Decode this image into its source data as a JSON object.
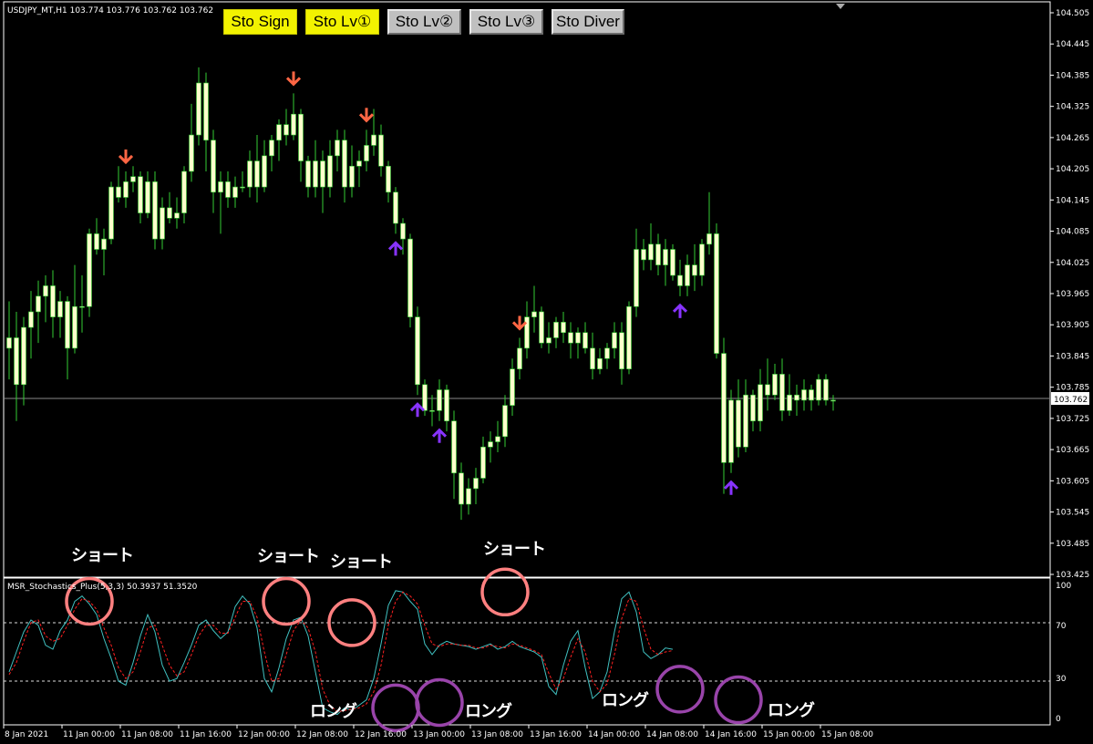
{
  "header": {
    "symbol_info": "USDJPY_MT,H1  103.774 103.776 103.762 103.762",
    "indicator_info": "MSR_Stochastics_Plus(5,3,3) 50.3937 51.3520"
  },
  "buttons": [
    {
      "label": "Sto Sign",
      "active": true
    },
    {
      "label": "Sto Lv①",
      "active": true
    },
    {
      "label": "Sto Lv②",
      "active": false
    },
    {
      "label": "Sto Lv③",
      "active": false
    },
    {
      "label": "Sto Diver",
      "active": false
    }
  ],
  "price_axis": {
    "ticks": [
      "104.505",
      "104.445",
      "104.385",
      "104.325",
      "104.265",
      "104.205",
      "104.145",
      "104.085",
      "104.025",
      "103.965",
      "103.905",
      "103.845",
      "103.785",
      "103.725",
      "103.665",
      "103.605",
      "103.545",
      "103.485",
      "103.425"
    ],
    "current_price": "103.762"
  },
  "osc_axis": {
    "ticks": [
      "100",
      "70",
      "30",
      "0"
    ]
  },
  "time_axis": {
    "labels": [
      "8 Jan 2021",
      "11 Jan 00:00",
      "11 Jan 08:00",
      "11 Jan 16:00",
      "12 Jan 00:00",
      "12 Jan 08:00",
      "12 Jan 16:00",
      "13 Jan 00:00",
      "13 Jan 08:00",
      "13 Jan 16:00",
      "14 Jan 00:00",
      "14 Jan 08:00",
      "14 Jan 16:00",
      "15 Jan 00:00",
      "15 Jan 08:00"
    ]
  },
  "annotations": {
    "short_1": "ショート",
    "short_2": "ショート",
    "short_3": "ショート",
    "short_4": "ショート",
    "long_1": "ロング",
    "long_2": "ロング",
    "long_3": "ロング",
    "long_4": "ロング"
  },
  "colors": {
    "bull_candle": "#ffffcc",
    "bear_candle": "#ffffcc",
    "wick": "#33cc33",
    "sell_arrow": "#ff6644",
    "buy_arrow": "#8833ff",
    "stoch_main": "#40c0c0",
    "stoch_signal": "#ff2020",
    "short_circle": "#ff8080",
    "long_circle": "#9944aa",
    "button_active": "#f2f200",
    "button_inactive": "#c0c0c0"
  },
  "chart_data": [
    {
      "type": "candlestick",
      "title": "USDJPY_MT,H1",
      "ylim": [
        103.425,
        104.52
      ],
      "candles": [
        [
          103.86,
          103.95,
          103.8,
          103.88
        ],
        [
          103.88,
          103.93,
          103.72,
          103.79
        ],
        [
          103.79,
          103.92,
          103.75,
          103.9
        ],
        [
          103.9,
          103.97,
          103.84,
          103.93
        ],
        [
          103.93,
          103.99,
          103.87,
          103.96
        ],
        [
          103.96,
          104.0,
          103.91,
          103.98
        ],
        [
          103.98,
          104.01,
          103.88,
          103.92
        ],
        [
          103.92,
          103.97,
          103.88,
          103.95
        ],
        [
          103.95,
          103.96,
          103.8,
          103.86
        ],
        [
          103.86,
          104.02,
          103.85,
          103.94
        ],
        [
          103.94,
          104.0,
          103.89,
          103.94
        ],
        [
          103.94,
          104.09,
          103.92,
          104.08
        ],
        [
          104.08,
          104.11,
          104.04,
          104.05
        ],
        [
          104.05,
          104.09,
          104.0,
          104.07
        ],
        [
          104.07,
          104.18,
          104.06,
          104.17
        ],
        [
          104.17,
          104.21,
          104.14,
          104.15
        ],
        [
          104.15,
          104.2,
          104.13,
          104.18
        ],
        [
          104.18,
          104.21,
          104.16,
          104.19
        ],
        [
          104.19,
          104.2,
          104.1,
          104.12
        ],
        [
          104.12,
          104.2,
          104.11,
          104.18
        ],
        [
          104.18,
          104.2,
          104.05,
          104.07
        ],
        [
          104.07,
          104.15,
          104.05,
          104.13
        ],
        [
          104.13,
          104.16,
          104.1,
          104.11
        ],
        [
          104.11,
          104.15,
          104.09,
          104.12
        ],
        [
          104.12,
          104.21,
          104.1,
          104.2
        ],
        [
          104.2,
          104.33,
          104.18,
          104.27
        ],
        [
          104.27,
          104.4,
          104.25,
          104.37
        ],
        [
          104.37,
          104.39,
          104.2,
          104.26
        ],
        [
          104.26,
          104.28,
          104.12,
          104.16
        ],
        [
          104.16,
          104.2,
          104.08,
          104.18
        ],
        [
          104.18,
          104.2,
          104.13,
          104.15
        ],
        [
          104.15,
          104.19,
          104.13,
          104.17
        ],
        [
          104.17,
          104.2,
          104.16,
          104.17
        ],
        [
          104.17,
          104.24,
          104.15,
          104.22
        ],
        [
          104.22,
          104.27,
          104.14,
          104.17
        ],
        [
          104.17,
          104.26,
          104.16,
          104.23
        ],
        [
          104.23,
          104.27,
          104.2,
          104.26
        ],
        [
          104.26,
          104.3,
          104.22,
          104.29
        ],
        [
          104.29,
          104.32,
          104.25,
          104.27
        ],
        [
          104.27,
          104.35,
          104.26,
          104.31
        ],
        [
          104.31,
          104.32,
          104.18,
          104.22
        ],
        [
          104.22,
          104.23,
          104.15,
          104.17
        ],
        [
          104.17,
          104.26,
          104.15,
          104.22
        ],
        [
          104.22,
          104.24,
          104.12,
          104.17
        ],
        [
          104.17,
          104.26,
          104.15,
          104.23
        ],
        [
          104.23,
          104.28,
          104.2,
          104.26
        ],
        [
          104.26,
          104.28,
          104.14,
          104.17
        ],
        [
          104.17,
          104.25,
          104.15,
          104.21
        ],
        [
          104.21,
          104.24,
          104.17,
          104.22
        ],
        [
          104.22,
          104.28,
          104.2,
          104.25
        ],
        [
          104.25,
          104.32,
          104.23,
          104.27
        ],
        [
          104.27,
          104.29,
          104.19,
          104.21
        ],
        [
          104.21,
          104.22,
          104.14,
          104.16
        ],
        [
          104.16,
          104.17,
          104.08,
          104.1
        ],
        [
          104.1,
          104.11,
          104.04,
          104.07
        ],
        [
          104.07,
          104.08,
          103.9,
          103.92
        ],
        [
          103.92,
          103.94,
          103.77,
          103.79
        ],
        [
          103.79,
          103.8,
          103.73,
          103.74
        ],
        [
          103.74,
          103.77,
          103.71,
          103.74
        ],
        [
          103.74,
          103.8,
          103.72,
          103.78
        ],
        [
          103.78,
          103.79,
          103.7,
          103.72
        ],
        [
          103.72,
          103.74,
          103.57,
          103.62
        ],
        [
          103.62,
          103.64,
          103.53,
          103.56
        ],
        [
          103.56,
          103.61,
          103.54,
          103.59
        ],
        [
          103.59,
          103.63,
          103.56,
          103.61
        ],
        [
          103.61,
          103.69,
          103.6,
          103.67
        ],
        [
          103.67,
          103.7,
          103.64,
          103.68
        ],
        [
          103.68,
          103.72,
          103.66,
          103.69
        ],
        [
          103.69,
          103.77,
          103.67,
          103.75
        ],
        [
          103.75,
          103.84,
          103.73,
          103.82
        ],
        [
          103.82,
          103.88,
          103.8,
          103.86
        ],
        [
          103.86,
          103.95,
          103.84,
          103.92
        ],
        [
          103.92,
          103.98,
          103.89,
          103.93
        ],
        [
          103.93,
          103.94,
          103.86,
          103.87
        ],
        [
          103.87,
          103.91,
          103.85,
          103.88
        ],
        [
          103.88,
          103.92,
          103.86,
          103.91
        ],
        [
          103.91,
          103.93,
          103.87,
          103.89
        ],
        [
          103.89,
          103.91,
          103.84,
          103.87
        ],
        [
          103.87,
          103.9,
          103.84,
          103.89
        ],
        [
          103.89,
          103.91,
          103.85,
          103.86
        ],
        [
          103.86,
          103.89,
          103.8,
          103.82
        ],
        [
          103.82,
          103.86,
          103.81,
          103.84
        ],
        [
          103.84,
          103.87,
          103.82,
          103.86
        ],
        [
          103.86,
          103.91,
          103.84,
          103.89
        ],
        [
          103.89,
          103.91,
          103.79,
          103.82
        ],
        [
          103.82,
          103.95,
          103.81,
          103.94
        ],
        [
          103.94,
          104.09,
          103.92,
          104.05
        ],
        [
          104.05,
          104.07,
          104.01,
          104.03
        ],
        [
          104.03,
          104.1,
          104.01,
          104.06
        ],
        [
          104.06,
          104.08,
          104.0,
          104.02
        ],
        [
          104.02,
          104.07,
          103.98,
          104.05
        ],
        [
          104.05,
          104.06,
          103.99,
          104.0
        ],
        [
          104.0,
          104.03,
          103.96,
          103.98
        ],
        [
          103.98,
          104.04,
          103.96,
          104.02
        ],
        [
          104.02,
          104.06,
          103.97,
          104.0
        ],
        [
          104.0,
          104.07,
          103.98,
          104.06
        ],
        [
          104.06,
          104.16,
          104.04,
          104.08
        ],
        [
          104.08,
          104.1,
          103.84,
          103.85
        ],
        [
          103.85,
          103.88,
          103.58,
          103.64
        ],
        [
          103.64,
          103.78,
          103.62,
          103.76
        ],
        [
          103.76,
          103.8,
          103.65,
          103.67
        ],
        [
          103.67,
          103.8,
          103.66,
          103.77
        ],
        [
          103.77,
          103.78,
          103.7,
          103.72
        ],
        [
          103.72,
          103.82,
          103.7,
          103.79
        ],
        [
          103.79,
          103.84,
          103.74,
          103.77
        ],
        [
          103.77,
          103.83,
          103.76,
          103.81
        ],
        [
          103.81,
          103.84,
          103.72,
          103.74
        ],
        [
          103.74,
          103.81,
          103.73,
          103.77
        ],
        [
          103.77,
          103.79,
          103.73,
          103.76
        ],
        [
          103.76,
          103.8,
          103.74,
          103.78
        ],
        [
          103.78,
          103.79,
          103.74,
          103.76
        ],
        [
          103.76,
          103.81,
          103.75,
          103.8
        ],
        [
          103.8,
          103.81,
          103.75,
          103.76
        ],
        [
          103.76,
          103.77,
          103.74,
          103.76
        ]
      ],
      "sell_signals": [
        16,
        39,
        49,
        70
      ],
      "buy_signals": [
        53,
        56,
        59,
        92,
        99
      ],
      "current_price": 103.762
    },
    {
      "type": "line",
      "title": "MSR_Stochastics_Plus(5,3,3)",
      "ylim": [
        0,
        100
      ],
      "levels": [
        70,
        30
      ],
      "series": [
        {
          "name": "main",
          "values": [
            35,
            50,
            65,
            74,
            70,
            55,
            52,
            66,
            74,
            88,
            92,
            86,
            78,
            60,
            45,
            28,
            25,
            42,
            62,
            78,
            65,
            40,
            28,
            30,
            42,
            55,
            70,
            74,
            66,
            60,
            65,
            84,
            92,
            86,
            68,
            30,
            20,
            38,
            60,
            74,
            76,
            62,
            35,
            8,
            5,
            3,
            8,
            6,
            10,
            14,
            30,
            56,
            85,
            96,
            95,
            88,
            82,
            56,
            48,
            55,
            58,
            56,
            55,
            54,
            52,
            54,
            56,
            52,
            54,
            58,
            54,
            52,
            50,
            46,
            24,
            18,
            40,
            58,
            66,
            38,
            15,
            20,
            35,
            65,
            90,
            95,
            80,
            50,
            45,
            48,
            53,
            52
          ]
        },
        {
          "name": "signal",
          "values": [
            33,
            42,
            58,
            72,
            74,
            62,
            58,
            60,
            70,
            82,
            90,
            88,
            82,
            68,
            55,
            38,
            30,
            35,
            50,
            68,
            70,
            55,
            40,
            32,
            35,
            48,
            62,
            70,
            70,
            64,
            64,
            76,
            88,
            88,
            76,
            50,
            28,
            30,
            48,
            66,
            74,
            68,
            50,
            22,
            10,
            5,
            6,
            7,
            8,
            11,
            20,
            40,
            70,
            88,
            95,
            92,
            86,
            70,
            56,
            54,
            56,
            56,
            55,
            55,
            53,
            53,
            55,
            54,
            53,
            56,
            55,
            53,
            51,
            48,
            34,
            22,
            30,
            46,
            60,
            50,
            28,
            20,
            26,
            48,
            75,
            90,
            88,
            68,
            52,
            48,
            50,
            51
          ]
        }
      ]
    }
  ]
}
